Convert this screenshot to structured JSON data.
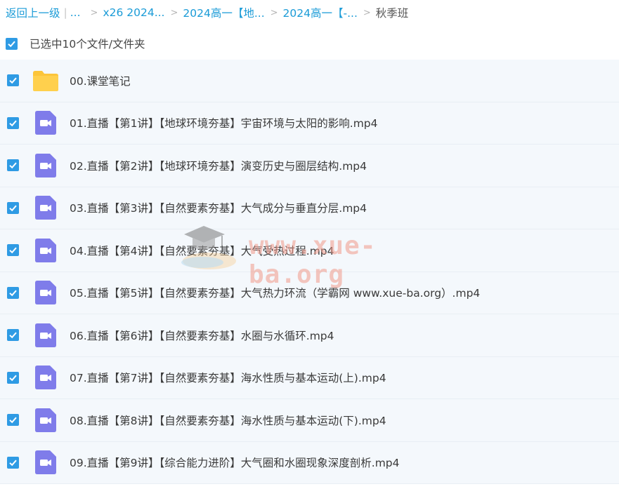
{
  "breadcrumb": {
    "back_label": "返回上一级",
    "separator": "|",
    "ellipsis": "...",
    "items": [
      "x26 2024...",
      "2024高一【地...",
      "2024高一【-..."
    ],
    "current": "秋季班"
  },
  "selection": {
    "status_text": "已选中10个文件/文件夹"
  },
  "files": [
    {
      "name": "00.课堂笔记",
      "type": "folder"
    },
    {
      "name": "01.直播【第1讲】【地球环境夯基】宇宙环境与太阳的影响.mp4",
      "type": "video"
    },
    {
      "name": "02.直播【第2讲】【地球环境夯基】演变历史与圈层结构.mp4",
      "type": "video"
    },
    {
      "name": "03.直播【第3讲】【自然要素夯基】大气成分与垂直分层.mp4",
      "type": "video"
    },
    {
      "name": "04.直播【第4讲】【自然要素夯基】大气受热过程.mp4",
      "type": "video"
    },
    {
      "name": "05.直播【第5讲】【自然要素夯基】大气热力环流（学霸网 www.xue-ba.org）.mp4",
      "type": "video"
    },
    {
      "name": "06.直播【第6讲】【自然要素夯基】水圈与水循环.mp4",
      "type": "video"
    },
    {
      "name": "07.直播【第7讲】【自然要素夯基】海水性质与基本运动(上).mp4",
      "type": "video"
    },
    {
      "name": "08.直播【第8讲】【自然要素夯基】海水性质与基本运动(下).mp4",
      "type": "video"
    },
    {
      "name": "09.直播【第9讲】【综合能力进阶】大气圈和水圈现象深度剖析.mp4",
      "type": "video"
    }
  ],
  "watermark": {
    "text": "www.xue-ba.org"
  },
  "colors": {
    "link": "#1a9bd7",
    "checkbox": "#2f9be4",
    "folder": "#fcc53a",
    "video": "#7f7cea",
    "row_bg": "#f4f8fc"
  }
}
